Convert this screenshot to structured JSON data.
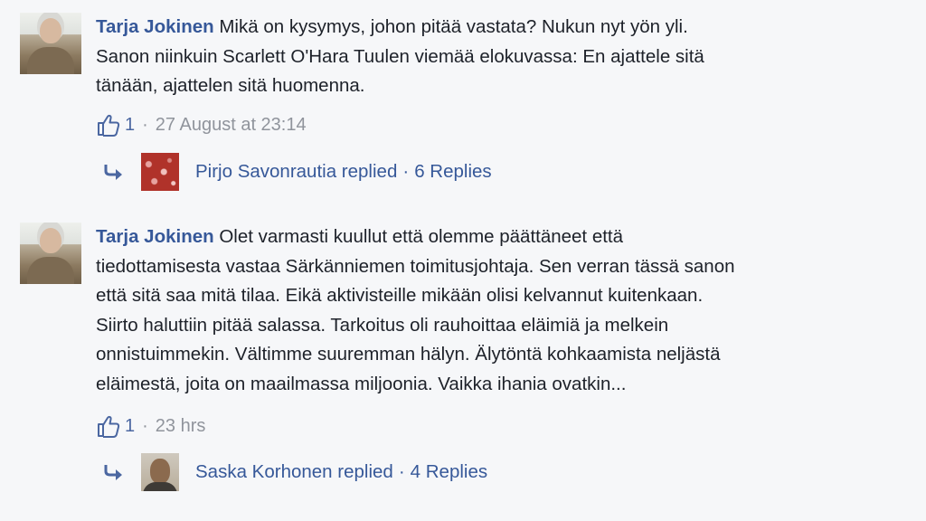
{
  "comments": [
    {
      "author": "Tarja Jokinen",
      "lines": [
        "Mikä on kysymys, johon pitää vastata? Nukun nyt yön yli.",
        "Sanon niinkuin Scarlett O'Hara Tuulen viemää elokuvassa: En ajattele sitä",
        "tänään, ajattelen sitä huomenna."
      ],
      "likes": "1",
      "separator": "·",
      "timestamp": "27 August at 23:14",
      "reply": {
        "text": "Pirjo Savonrautia replied",
        "separator": "·",
        "count": "6 Replies"
      }
    },
    {
      "author": "Tarja Jokinen",
      "lines": [
        "Olet varmasti kuullut että olemme päättäneet että",
        "tiedottamisesta vastaa Särkänniemen toimitusjohtaja. Sen verran tässä sanon",
        "että sitä saa mitä tilaa. Eikä aktivisteille mikään olisi kelvannut kuitenkaan.",
        "Siirto haluttiin pitää salassa. Tarkoitus oli rauhoittaa eläimiä ja melkein",
        "onnistuimmekin. Vältimme suuremman hälyn. Älytöntä kohkaamista neljästä",
        "eläimestä, joita on maailmassa miljoonia. Vaikka ihania ovatkin..."
      ],
      "likes": "1",
      "separator": "·",
      "timestamp": "23 hrs",
      "reply": {
        "text": "Saska Korhonen replied",
        "separator": "·",
        "count": "4 Replies"
      }
    }
  ],
  "icons": {
    "like": "thumbs-up-icon",
    "reply": "reply-arrow-icon"
  },
  "colors": {
    "background": "#f6f7f9",
    "author": "#365899",
    "meta": "#90949c",
    "like_count": "#4b67a1",
    "text": "#1d2129"
  }
}
